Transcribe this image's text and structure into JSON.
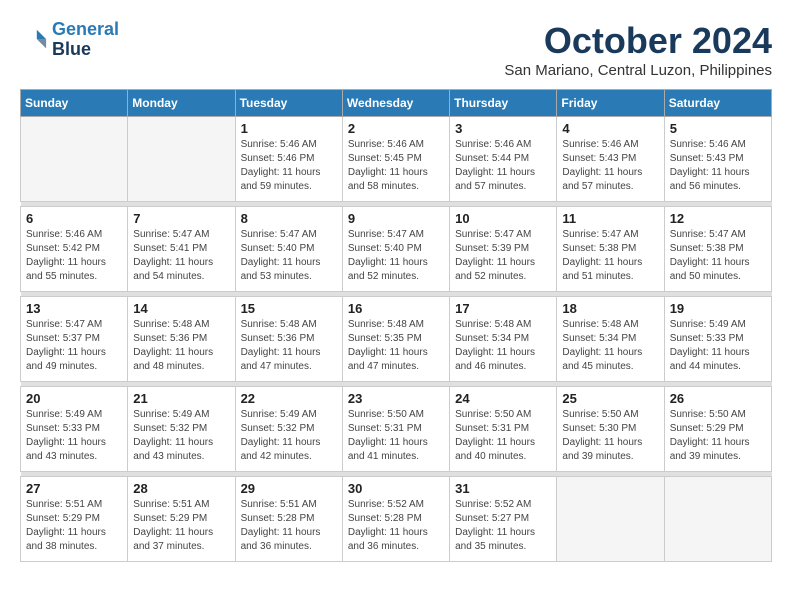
{
  "header": {
    "logo_line1": "General",
    "logo_line2": "Blue",
    "month": "October 2024",
    "location": "San Mariano, Central Luzon, Philippines"
  },
  "days_of_week": [
    "Sunday",
    "Monday",
    "Tuesday",
    "Wednesday",
    "Thursday",
    "Friday",
    "Saturday"
  ],
  "weeks": [
    [
      {
        "day": "",
        "empty": true
      },
      {
        "day": "",
        "empty": true
      },
      {
        "day": "1",
        "sunrise": "Sunrise: 5:46 AM",
        "sunset": "Sunset: 5:46 PM",
        "daylight": "Daylight: 11 hours and 59 minutes."
      },
      {
        "day": "2",
        "sunrise": "Sunrise: 5:46 AM",
        "sunset": "Sunset: 5:45 PM",
        "daylight": "Daylight: 11 hours and 58 minutes."
      },
      {
        "day": "3",
        "sunrise": "Sunrise: 5:46 AM",
        "sunset": "Sunset: 5:44 PM",
        "daylight": "Daylight: 11 hours and 57 minutes."
      },
      {
        "day": "4",
        "sunrise": "Sunrise: 5:46 AM",
        "sunset": "Sunset: 5:43 PM",
        "daylight": "Daylight: 11 hours and 57 minutes."
      },
      {
        "day": "5",
        "sunrise": "Sunrise: 5:46 AM",
        "sunset": "Sunset: 5:43 PM",
        "daylight": "Daylight: 11 hours and 56 minutes."
      }
    ],
    [
      {
        "day": "6",
        "sunrise": "Sunrise: 5:46 AM",
        "sunset": "Sunset: 5:42 PM",
        "daylight": "Daylight: 11 hours and 55 minutes."
      },
      {
        "day": "7",
        "sunrise": "Sunrise: 5:47 AM",
        "sunset": "Sunset: 5:41 PM",
        "daylight": "Daylight: 11 hours and 54 minutes."
      },
      {
        "day": "8",
        "sunrise": "Sunrise: 5:47 AM",
        "sunset": "Sunset: 5:40 PM",
        "daylight": "Daylight: 11 hours and 53 minutes."
      },
      {
        "day": "9",
        "sunrise": "Sunrise: 5:47 AM",
        "sunset": "Sunset: 5:40 PM",
        "daylight": "Daylight: 11 hours and 52 minutes."
      },
      {
        "day": "10",
        "sunrise": "Sunrise: 5:47 AM",
        "sunset": "Sunset: 5:39 PM",
        "daylight": "Daylight: 11 hours and 52 minutes."
      },
      {
        "day": "11",
        "sunrise": "Sunrise: 5:47 AM",
        "sunset": "Sunset: 5:38 PM",
        "daylight": "Daylight: 11 hours and 51 minutes."
      },
      {
        "day": "12",
        "sunrise": "Sunrise: 5:47 AM",
        "sunset": "Sunset: 5:38 PM",
        "daylight": "Daylight: 11 hours and 50 minutes."
      }
    ],
    [
      {
        "day": "13",
        "sunrise": "Sunrise: 5:47 AM",
        "sunset": "Sunset: 5:37 PM",
        "daylight": "Daylight: 11 hours and 49 minutes."
      },
      {
        "day": "14",
        "sunrise": "Sunrise: 5:48 AM",
        "sunset": "Sunset: 5:36 PM",
        "daylight": "Daylight: 11 hours and 48 minutes."
      },
      {
        "day": "15",
        "sunrise": "Sunrise: 5:48 AM",
        "sunset": "Sunset: 5:36 PM",
        "daylight": "Daylight: 11 hours and 47 minutes."
      },
      {
        "day": "16",
        "sunrise": "Sunrise: 5:48 AM",
        "sunset": "Sunset: 5:35 PM",
        "daylight": "Daylight: 11 hours and 47 minutes."
      },
      {
        "day": "17",
        "sunrise": "Sunrise: 5:48 AM",
        "sunset": "Sunset: 5:34 PM",
        "daylight": "Daylight: 11 hours and 46 minutes."
      },
      {
        "day": "18",
        "sunrise": "Sunrise: 5:48 AM",
        "sunset": "Sunset: 5:34 PM",
        "daylight": "Daylight: 11 hours and 45 minutes."
      },
      {
        "day": "19",
        "sunrise": "Sunrise: 5:49 AM",
        "sunset": "Sunset: 5:33 PM",
        "daylight": "Daylight: 11 hours and 44 minutes."
      }
    ],
    [
      {
        "day": "20",
        "sunrise": "Sunrise: 5:49 AM",
        "sunset": "Sunset: 5:33 PM",
        "daylight": "Daylight: 11 hours and 43 minutes."
      },
      {
        "day": "21",
        "sunrise": "Sunrise: 5:49 AM",
        "sunset": "Sunset: 5:32 PM",
        "daylight": "Daylight: 11 hours and 43 minutes."
      },
      {
        "day": "22",
        "sunrise": "Sunrise: 5:49 AM",
        "sunset": "Sunset: 5:32 PM",
        "daylight": "Daylight: 11 hours and 42 minutes."
      },
      {
        "day": "23",
        "sunrise": "Sunrise: 5:50 AM",
        "sunset": "Sunset: 5:31 PM",
        "daylight": "Daylight: 11 hours and 41 minutes."
      },
      {
        "day": "24",
        "sunrise": "Sunrise: 5:50 AM",
        "sunset": "Sunset: 5:31 PM",
        "daylight": "Daylight: 11 hours and 40 minutes."
      },
      {
        "day": "25",
        "sunrise": "Sunrise: 5:50 AM",
        "sunset": "Sunset: 5:30 PM",
        "daylight": "Daylight: 11 hours and 39 minutes."
      },
      {
        "day": "26",
        "sunrise": "Sunrise: 5:50 AM",
        "sunset": "Sunset: 5:29 PM",
        "daylight": "Daylight: 11 hours and 39 minutes."
      }
    ],
    [
      {
        "day": "27",
        "sunrise": "Sunrise: 5:51 AM",
        "sunset": "Sunset: 5:29 PM",
        "daylight": "Daylight: 11 hours and 38 minutes."
      },
      {
        "day": "28",
        "sunrise": "Sunrise: 5:51 AM",
        "sunset": "Sunset: 5:29 PM",
        "daylight": "Daylight: 11 hours and 37 minutes."
      },
      {
        "day": "29",
        "sunrise": "Sunrise: 5:51 AM",
        "sunset": "Sunset: 5:28 PM",
        "daylight": "Daylight: 11 hours and 36 minutes."
      },
      {
        "day": "30",
        "sunrise": "Sunrise: 5:52 AM",
        "sunset": "Sunset: 5:28 PM",
        "daylight": "Daylight: 11 hours and 36 minutes."
      },
      {
        "day": "31",
        "sunrise": "Sunrise: 5:52 AM",
        "sunset": "Sunset: 5:27 PM",
        "daylight": "Daylight: 11 hours and 35 minutes."
      },
      {
        "day": "",
        "empty": true
      },
      {
        "day": "",
        "empty": true
      }
    ]
  ]
}
